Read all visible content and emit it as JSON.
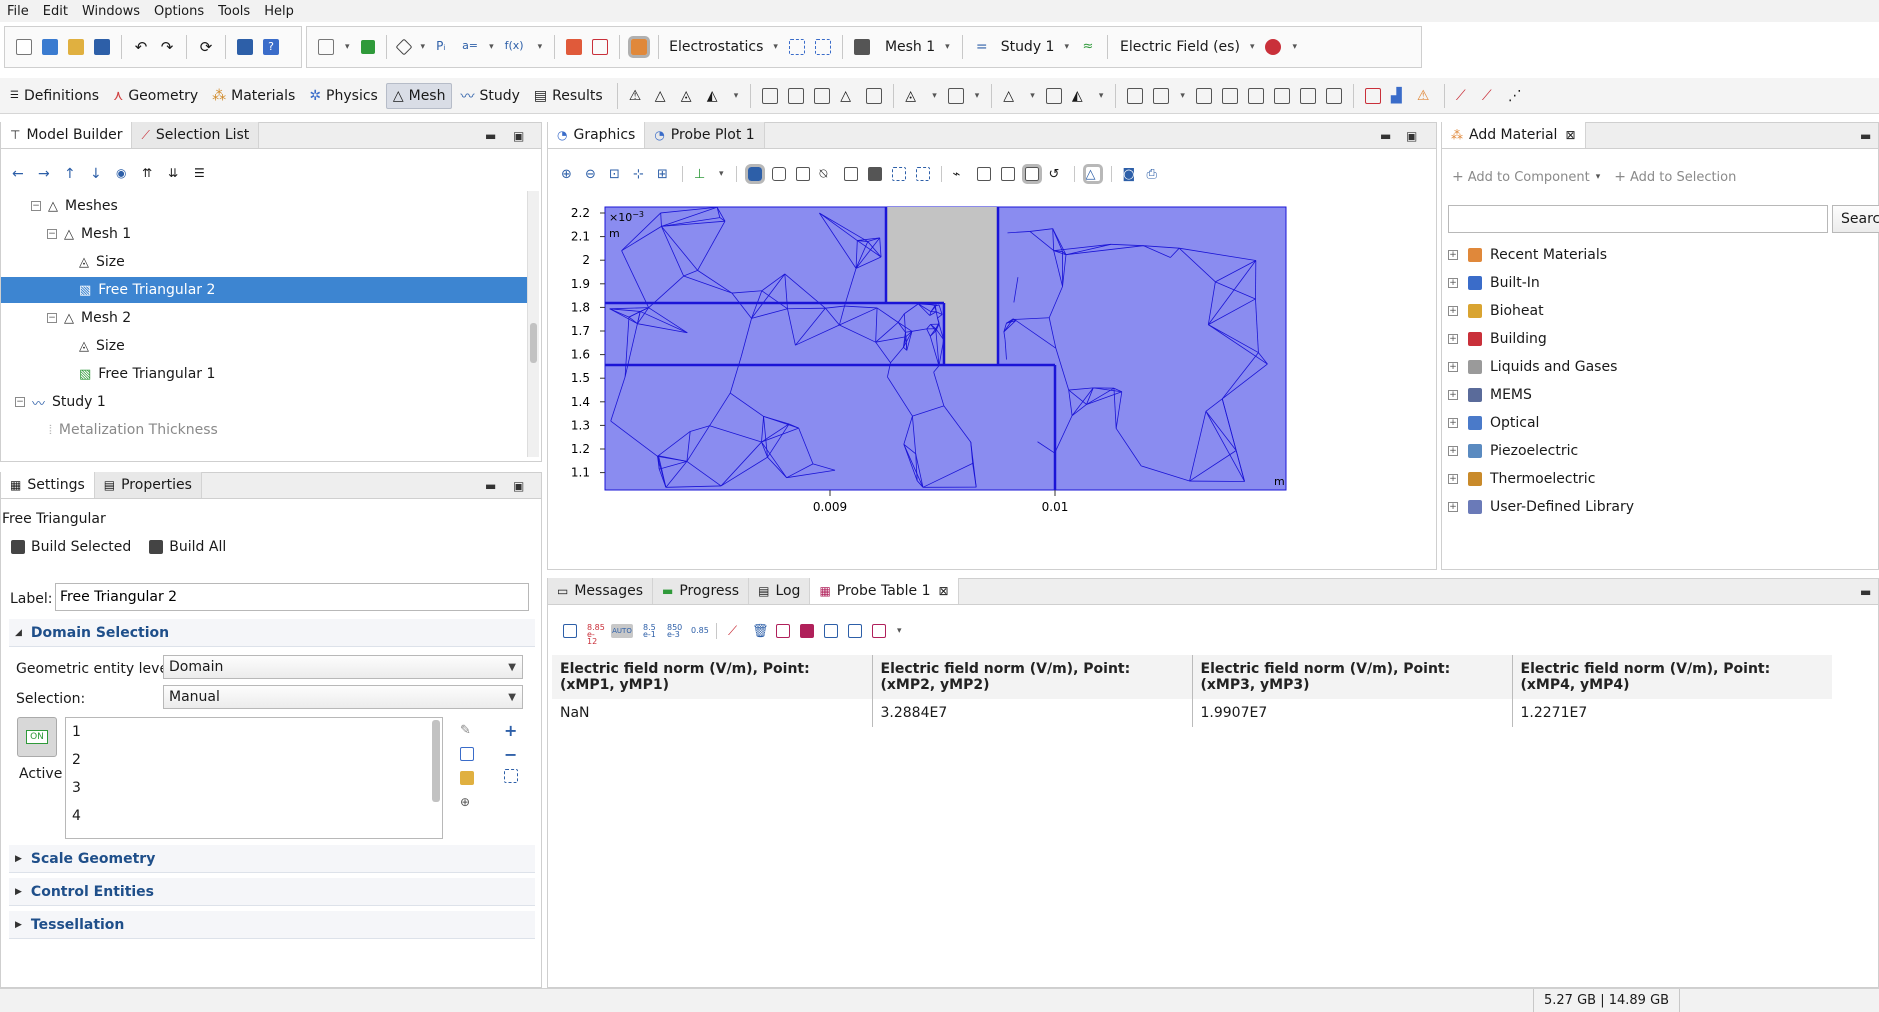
{
  "menu": [
    "File",
    "Edit",
    "Windows",
    "Options",
    "Tools",
    "Help"
  ],
  "toolbar": {
    "physics_label": "Electrostatics",
    "mesh_label": "Mesh 1",
    "study_label": "Study 1",
    "plot_label": "Electric Field (es)"
  },
  "ribbon": {
    "tabs": [
      "Definitions",
      "Geometry",
      "Materials",
      "Physics",
      "Mesh",
      "Study",
      "Results"
    ],
    "active": "Mesh"
  },
  "model_builder": {
    "tabs": [
      "Model Builder",
      "Selection List"
    ],
    "tree": [
      {
        "label": "Meshes",
        "indent": 1,
        "expander": "−"
      },
      {
        "label": "Mesh 1",
        "indent": 2,
        "expander": "−"
      },
      {
        "label": "Size",
        "indent": 3,
        "expander": ""
      },
      {
        "label": "Free Triangular 2",
        "indent": 3,
        "expander": ""
      },
      {
        "label": "Mesh 2",
        "indent": 2,
        "expander": "−"
      },
      {
        "label": "Size",
        "indent": 3,
        "expander": ""
      },
      {
        "label": "Free Triangular 1",
        "indent": 3,
        "expander": ""
      },
      {
        "label": "Study 1",
        "indent": 1,
        "expander": "−"
      },
      {
        "label": "Metalization Thickness",
        "indent": 2,
        "expander": ""
      }
    ]
  },
  "settings": {
    "tabs": [
      "Settings",
      "Properties"
    ],
    "node_title": "Free Triangular",
    "build_selected": "Build Selected",
    "build_all": "Build All",
    "label_caption": "Label:",
    "label_value": "Free Triangular 2",
    "domain_selection": "Domain Selection",
    "geom_level_caption": "Geometric entity level:",
    "geom_level_value": "Domain",
    "selection_caption": "Selection:",
    "selection_value": "Manual",
    "active_label": "Active",
    "active_toggle": "ON",
    "domains": [
      "1",
      "2",
      "3",
      "4"
    ],
    "sections": [
      "Scale Geometry",
      "Control Entities",
      "Tessellation"
    ]
  },
  "graphics": {
    "tabs": [
      "Graphics",
      "Probe Plot 1"
    ],
    "y_ticks": [
      "2.2",
      "2.1",
      "2",
      "1.9",
      "1.8",
      "1.7",
      "1.6",
      "1.5",
      "1.4",
      "1.3",
      "1.2",
      "1.1"
    ],
    "x_ticks": [
      "0.009",
      "0.01"
    ],
    "scale_label": "×10",
    "scale_exp": "−3",
    "axis_unit_y": "m",
    "axis_unit_x": "m",
    "mesh_color": "#8a8cf0",
    "line_color": "#1a14d6",
    "solid_color": "#c3c3c3"
  },
  "probe": {
    "tabs": [
      "Messages",
      "Progress",
      "Log",
      "Probe Table 1"
    ],
    "headers": [
      "Electric field norm (V/m), Point: (xMP1, yMP1)",
      "Electric field norm (V/m), Point: (xMP2, yMP2)",
      "Electric field norm (V/m), Point: (xMP3, yMP3)",
      "Electric field norm (V/m), Point: (xMP4, yMP4)"
    ],
    "rows": [
      [
        "NaN",
        "3.2884E7",
        "1.9907E7",
        "1.2271E7"
      ]
    ]
  },
  "add_material": {
    "tab": "Add Material",
    "add_to_component": "Add to Component",
    "add_to_selection": "Add to Selection",
    "search_button": "Search",
    "items": [
      {
        "label": "Recent Materials",
        "color": "#e0883a"
      },
      {
        "label": "Built-In",
        "color": "#3a6cc9"
      },
      {
        "label": "Bioheat",
        "color": "#d9a431"
      },
      {
        "label": "Building",
        "color": "#c9303a"
      },
      {
        "label": "Liquids and Gases",
        "color": "#9a9a9a"
      },
      {
        "label": "MEMS",
        "color": "#5a6b9a"
      },
      {
        "label": "Optical",
        "color": "#4a7ac9"
      },
      {
        "label": "Piezoelectric",
        "color": "#5a8ac0"
      },
      {
        "label": "Thermoelectric",
        "color": "#c98a2a"
      },
      {
        "label": "User-Defined Library",
        "color": "#6a7ab8"
      }
    ]
  },
  "status": {
    "memory": "5.27 GB | 14.89 GB"
  }
}
